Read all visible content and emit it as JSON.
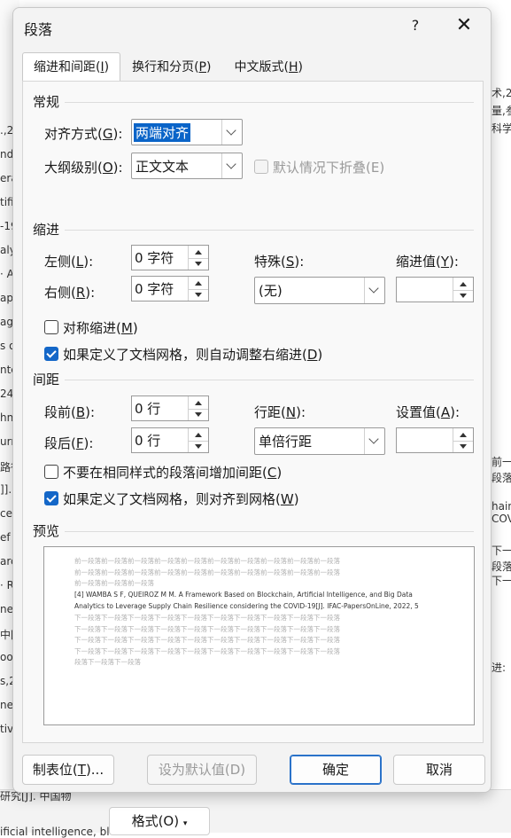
{
  "background_doc": {
    "left_lines": [
      ".,2(",
      "nd",
      "era",
      "tifi",
      "-19",
      "alyt",
      "· A",
      "apa",
      "age",
      "s of",
      "nte",
      "243",
      "hn",
      "urr",
      "路径",
      "]].",
      "ce-",
      "ef",
      "arch",
      "· R",
      "ner",
      "中国",
      "oon",
      "s,2",
      "nec",
      "tiv"
    ],
    "right_lines": [
      "术,2",
      "量,参",
      "科学",
      "前一",
      "段落",
      "hain",
      "COV",
      "下一",
      "段落",
      "下一",
      "进:"
    ],
    "bottom_text": "研究[J]. 中国物",
    "bottom_text2": "ificial intelligence, bl",
    "format_button": "格式(O)"
  },
  "dialog": {
    "title": "段落",
    "help": "?",
    "close": "✕",
    "tabs": [
      {
        "label": "缩进和间距(",
        "key": "I",
        "tail": ")"
      },
      {
        "label": "换行和分页(",
        "key": "P",
        "tail": ")"
      },
      {
        "label": "中文版式(",
        "key": "H",
        "tail": ")"
      }
    ],
    "general": {
      "heading": "常规",
      "alignment_label_a": "对齐方式(",
      "alignment_key": "G",
      "alignment_label_b": "):",
      "alignment_value": "两端对齐",
      "outline_label_a": "大纲级别(",
      "outline_key": "O",
      "outline_label_b": "):",
      "outline_value": "正文文本",
      "collapse_label": "默认情况下折叠(E)"
    },
    "indent": {
      "heading": "缩进",
      "left_label_a": "左侧(",
      "left_key": "L",
      "left_label_b": "):",
      "left_value": "0 字符",
      "right_label_a": "右侧(",
      "right_key": "R",
      "right_label_b": "):",
      "right_value": "0 字符",
      "special_label_a": "特殊(",
      "special_key": "S",
      "special_label_b": "):",
      "special_value": "(无)",
      "indent_value_label_a": "缩进值(",
      "indent_value_key": "Y",
      "indent_value_label_b": "):",
      "indent_value": "",
      "mirror_label_a": "对称缩进(",
      "mirror_key": "M",
      "mirror_label_b": ")",
      "auto_adjust_label_a": "如果定义了文档网格，则自动调整右缩进(",
      "auto_adjust_key": "D",
      "auto_adjust_label_b": ")"
    },
    "spacing": {
      "heading": "间距",
      "before_label_a": "段前(",
      "before_key": "B",
      "before_label_b": "):",
      "before_value": "0 行",
      "after_label_a": "段后(",
      "after_key": "F",
      "after_label_b": "):",
      "after_value": "0 行",
      "line_label_a": "行距(",
      "line_key": "N",
      "line_label_b": "):",
      "line_value": "单倍行距",
      "set_label_a": "设置值(",
      "set_key": "A",
      "set_label_b": "):",
      "set_value": "",
      "no_space_label_a": "不要在相同样式的段落间增加间距(",
      "no_space_key": "C",
      "no_space_label_b": ")",
      "snap_label_a": "如果定义了文档网格，则对齐到网格(",
      "snap_key": "W",
      "snap_label_b": ")"
    },
    "preview": {
      "heading": "预览",
      "prev_lines": [
        "前一段落前一段落前一段落前一段落前一段落前一段落前一段落前一段落前一段落前一段落",
        "前一段落前一段落前一段落前一段落前一段落前一段落前一段落前一段落前一段落前一段落",
        "前一段落前一段落前一段落"
      ],
      "main_lines": [
        "[4]    WAMBA S F, QUEIROZ M M. A Framework Based on Blockchain, Artificial Intelligence, and Big Data",
        "Analytics to Leverage Supply Chain Resilience considering the COVID-19[J]. IFAC-PapersOnLine, 2022, 5"
      ],
      "next_lines": [
        "    下一段落下一段落下一段落下一段落下一段落下一段落下一段落下一段落下一段落下一段落",
        "下一段落下一段落下一段落下一段落下一段落下一段落下一段落下一段落下一段落下一段落",
        "下一段落下一段落下一段落下一段落下一段落下一段落下一段落下一段落下一段落下一段落",
        "下一段落下一段落下一段落下一段落下一段落下一段落下一段落下一段落下一段落下一段落",
        "段落下一段落下一段落"
      ]
    },
    "buttons": {
      "tabs_a": "制表位(",
      "tabs_key": "T",
      "tabs_b": ")...",
      "set_default": "设为默认值(D)",
      "ok": "确定",
      "cancel": "取消"
    }
  }
}
